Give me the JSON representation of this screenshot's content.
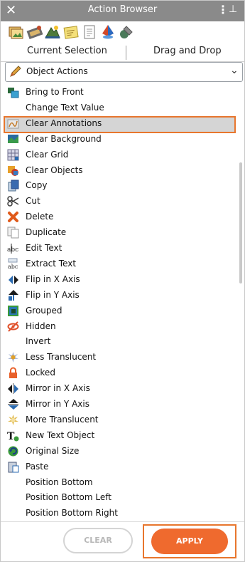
{
  "window": {
    "title": "Action Browser",
    "close_glyph": "✕",
    "menu_glyph": "⋮",
    "pin_glyph": "⊥"
  },
  "toolbar_icons": [
    "image-icon",
    "film-icon",
    "scene-icon",
    "sticky-note-icon",
    "document-icon",
    "pyramid-icon",
    "tools-icon"
  ],
  "tabs": [
    {
      "label": "Current Selection"
    },
    {
      "label": "Drag and Drop"
    }
  ],
  "dropdown": {
    "selected": "Object Actions",
    "icon": "pen-icon",
    "arrow": "⌄"
  },
  "actions": [
    {
      "label": "Bring to Front",
      "icon": "bring-front-icon"
    },
    {
      "label": "Change Text Value",
      "icon": ""
    },
    {
      "label": "Clear Annotations",
      "icon": "clear-annotations-icon"
    },
    {
      "label": "Clear Background",
      "icon": "clear-background-icon"
    },
    {
      "label": "Clear Grid",
      "icon": "grid-icon"
    },
    {
      "label": "Clear Objects",
      "icon": "clear-objects-icon"
    },
    {
      "label": "Copy",
      "icon": "copy-icon"
    },
    {
      "label": "Cut",
      "icon": "scissors-icon"
    },
    {
      "label": "Delete",
      "icon": "delete-icon"
    },
    {
      "label": "Duplicate",
      "icon": "duplicate-icon"
    },
    {
      "label": "Edit Text",
      "icon": "edit-text-icon"
    },
    {
      "label": "Extract Text",
      "icon": "extract-text-icon"
    },
    {
      "label": "Flip in X Axis",
      "icon": "flip-x-icon"
    },
    {
      "label": "Flip in Y Axis",
      "icon": "flip-y-icon"
    },
    {
      "label": "Grouped",
      "icon": "grouped-icon"
    },
    {
      "label": "Hidden",
      "icon": "hidden-icon"
    },
    {
      "label": "Invert",
      "icon": ""
    },
    {
      "label": "Less Translucent",
      "icon": "less-translucent-icon"
    },
    {
      "label": "Locked",
      "icon": "lock-icon"
    },
    {
      "label": "Mirror in X Axis",
      "icon": "mirror-x-icon"
    },
    {
      "label": "Mirror in Y Axis",
      "icon": "mirror-y-icon"
    },
    {
      "label": "More Translucent",
      "icon": "more-translucent-icon"
    },
    {
      "label": "New Text Object",
      "icon": "new-text-icon"
    },
    {
      "label": "Original Size",
      "icon": "original-size-icon"
    },
    {
      "label": "Paste",
      "icon": "paste-icon"
    },
    {
      "label": "Position Bottom",
      "icon": ""
    },
    {
      "label": "Position Bottom Left",
      "icon": ""
    },
    {
      "label": "Position Bottom Right",
      "icon": ""
    }
  ],
  "selected_index": 2,
  "buttons": {
    "clear": "CLEAR",
    "apply": "APPLY"
  },
  "colors": {
    "titlebar": "#8a8a8a",
    "accent_orange": "#ef6a2e",
    "highlight_border": "#e8762d",
    "selected_row": "#d5d5d5"
  }
}
